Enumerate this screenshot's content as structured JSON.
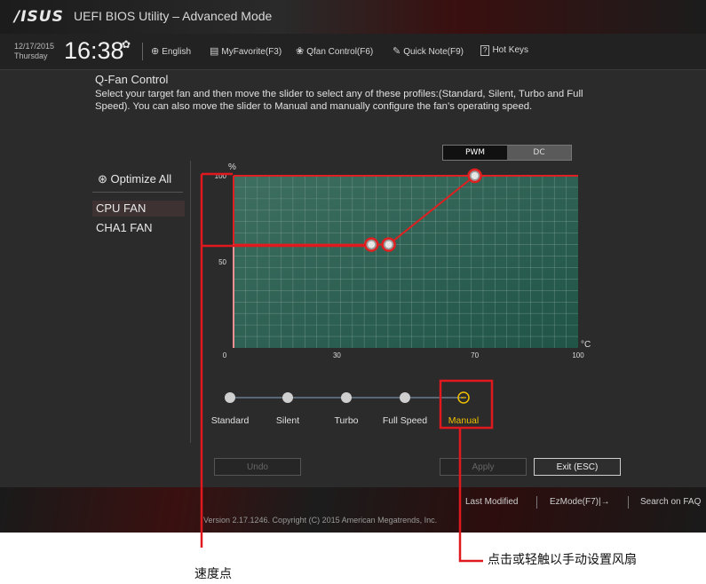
{
  "titlebar": {
    "logo": "/ISUS",
    "title": "UEFI BIOS Utility – Advanced Mode"
  },
  "toolbar": {
    "date": "12/17/2015",
    "day": "Thursday",
    "time": "16:38",
    "gear_icon": "gear-icon",
    "items": [
      {
        "icon": "globe-icon",
        "label": "English"
      },
      {
        "icon": "favorite-icon",
        "label": "MyFavorite(F3)"
      },
      {
        "icon": "fan-icon",
        "label": "Qfan Control(F6)"
      },
      {
        "icon": "note-icon",
        "label": "Quick Note(F9)"
      },
      {
        "icon": "hotkey-icon",
        "label": "Hot Keys",
        "box": "?"
      }
    ]
  },
  "page": {
    "title": "Q-Fan Control",
    "description": "Select your target fan and then move the slider to select any of these profiles:(Standard, Silent, Turbo and Full Speed). You can also move the slider to Manual and manually configure the fan’s operating speed."
  },
  "sidebar": {
    "optimize_label": "Optimize All",
    "fans": [
      {
        "label": "CPU FAN",
        "selected": true
      },
      {
        "label": "CHA1 FAN",
        "selected": false
      }
    ]
  },
  "mode_toggle": {
    "options": [
      "PWM",
      "DC"
    ],
    "selected": "PWM"
  },
  "chart_data": {
    "type": "line",
    "ylabel": "%",
    "xlabel": "°C",
    "xlim": [
      0,
      100
    ],
    "ylim": [
      0,
      100
    ],
    "xticks": [
      "0",
      "30",
      "70",
      "100"
    ],
    "yticks": [
      "100",
      "50"
    ],
    "points": [
      {
        "x": 40,
        "y": 60
      },
      {
        "x": 45,
        "y": 60
      },
      {
        "x": 70,
        "y": 100
      }
    ],
    "grid": true,
    "colors": {
      "plot_bg": "#2f6b5a",
      "line": "#e02020",
      "point": "#e6e6e6"
    }
  },
  "profiles": {
    "options": [
      "Standard",
      "Silent",
      "Turbo",
      "Full Speed",
      "Manual"
    ],
    "selected": "Manual",
    "accent": "#f0c000"
  },
  "buttons": {
    "undo": "Undo",
    "apply": "Apply",
    "exit": "Exit (ESC)"
  },
  "footer": {
    "last_modified": "Last Modified",
    "ezmode": "EzMode(F7)|→",
    "search": "Search on FAQ",
    "version": "Version 2.17.1246. Copyright (C) 2015 American Megatrends, Inc."
  },
  "callouts": {
    "speed_point": "速度点",
    "manual_tip": "点击或轻触以手动设置风扇"
  }
}
